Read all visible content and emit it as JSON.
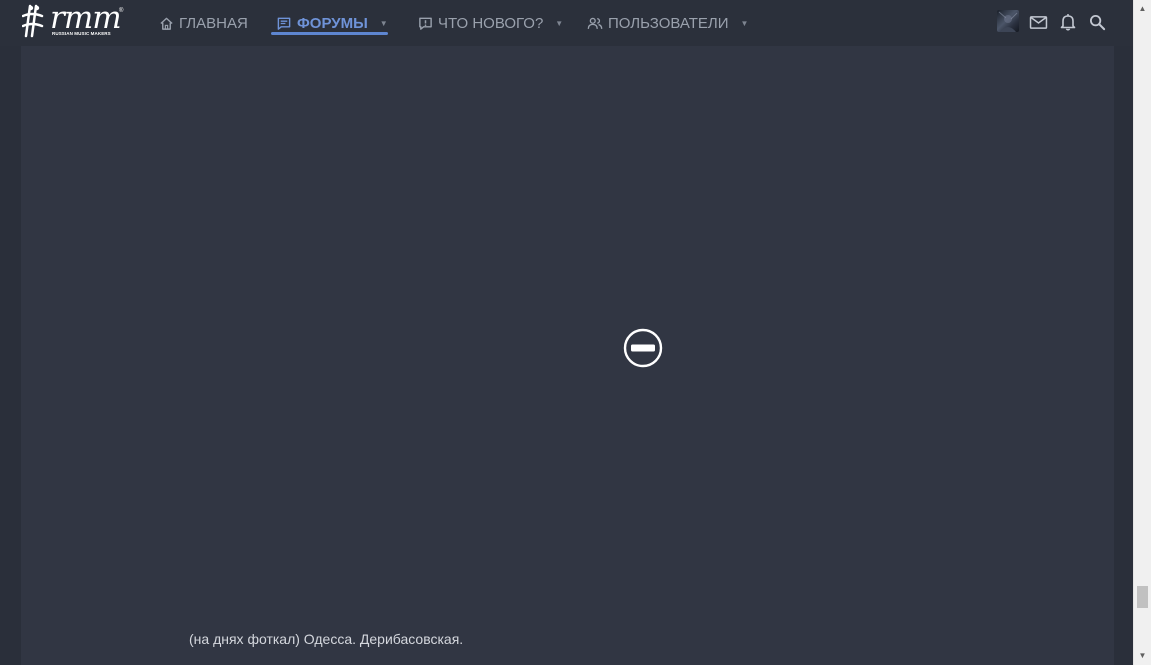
{
  "logo": {
    "text": "rmm",
    "registered": "®",
    "subtitle": "RUSSIAN MUSIC MAKERS"
  },
  "nav": {
    "items": [
      {
        "label": "ГЛАВНАЯ",
        "icon": "home-icon",
        "active": false,
        "has_dropdown": false
      },
      {
        "label": "ФОРУМЫ",
        "icon": "forum-icon",
        "active": true,
        "has_dropdown": true
      },
      {
        "label": "ЧТО НОВОГО?",
        "icon": "whats-new-icon",
        "active": false,
        "has_dropdown": true
      },
      {
        "label": "ПОЛЬЗОВАТЕЛИ",
        "icon": "users-icon",
        "active": false,
        "has_dropdown": true
      }
    ]
  },
  "header_icons": [
    "avatar",
    "mail-icon",
    "bell-icon",
    "search-icon"
  ],
  "content": {
    "blocked_media_icon": "blocked-icon",
    "caption": "(на днях фоткал) Одесса. Дерибасовская."
  },
  "colors": {
    "header_bg": "#2b303b",
    "panel_bg": "#313643",
    "page_bg": "#2a2f3a",
    "accent": "#5e86d1",
    "nav_text": "#9aa1ad"
  }
}
